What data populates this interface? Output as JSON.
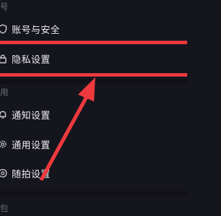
{
  "sections": {
    "top_label": "号",
    "general_label": "用",
    "bottom_label": "包"
  },
  "items": [
    {
      "label": "账号与安全",
      "icon": "shield-icon"
    },
    {
      "label": "隐私设置",
      "icon": "lock-icon"
    },
    {
      "label": "通知设置",
      "icon": "bell-icon"
    },
    {
      "label": "通用设置",
      "icon": "gear-icon"
    },
    {
      "label": "随拍设置",
      "icon": "camera-icon"
    }
  ],
  "annotation": {
    "highlight_color": "#ee3a3e",
    "arrow_color": "#ee3a3e",
    "highlighted_item": "隐私设置"
  },
  "colors": {
    "background": "#15151d",
    "text": "#ececf0",
    "section_label": "#6f6f7a"
  }
}
